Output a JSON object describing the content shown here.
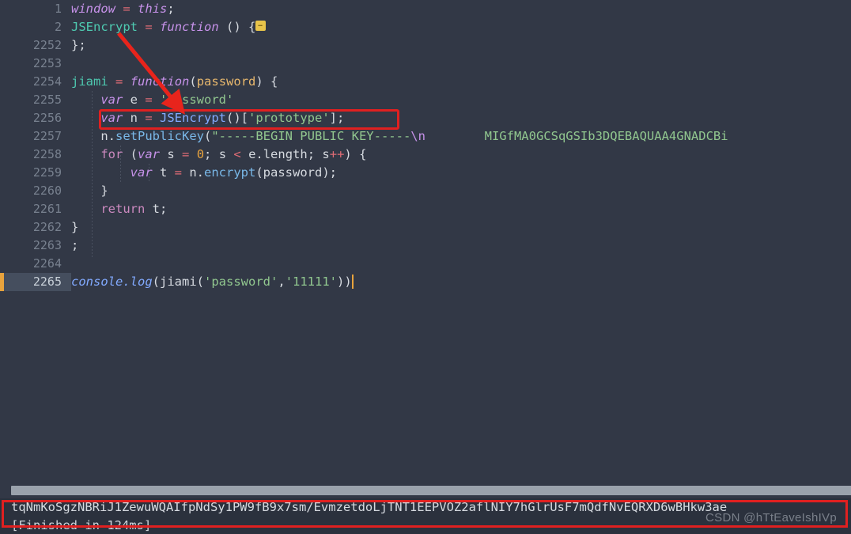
{
  "editor": {
    "background": "#323846",
    "gutter_active_bg": "#454e5e",
    "caret_color": "#e8a33d",
    "lines": [
      {
        "number": "1",
        "active": false
      },
      {
        "number": "2",
        "active": false
      },
      {
        "number": "2252",
        "active": false
      },
      {
        "number": "2253",
        "active": false
      },
      {
        "number": "2254",
        "active": false
      },
      {
        "number": "2255",
        "active": false
      },
      {
        "number": "2256",
        "active": false
      },
      {
        "number": "2257",
        "active": false
      },
      {
        "number": "2258",
        "active": false
      },
      {
        "number": "2259",
        "active": false
      },
      {
        "number": "2260",
        "active": false
      },
      {
        "number": "2261",
        "active": false
      },
      {
        "number": "2262",
        "active": false
      },
      {
        "number": "2263",
        "active": false
      },
      {
        "number": "2264",
        "active": false
      },
      {
        "number": "2265",
        "active": true
      }
    ],
    "code_text": [
      "window = this;",
      "JSEncrypt = function () {…",
      "};",
      "",
      "jiami = function(password) {",
      "    var e = 'password'",
      "    var n = JSEncrypt()['prototype'];",
      "    n.setPublicKey(\"-----BEGIN PUBLIC KEY-----\\n        MIGfMA0GCSqGSIb3DQEBAQUAA4GNADCBi",
      "    for (var s = 0; s < e.length; s++) {",
      "        var t = n.encrypt(password);",
      "    }",
      "    return t;",
      "}",
      ";",
      "",
      "console.log(jiami('password','11111'))"
    ],
    "fold_marker": "…"
  },
  "annotations": {
    "highlight_box_color": "#e02020",
    "arrow_color": "#e8241c",
    "arrow_from": "JSEncrypt = function",
    "arrow_to": "var n = JSEncrypt()['prototype'];"
  },
  "scrollbar": {
    "orientation": "horizontal",
    "thumb_color": "#9aa2ac"
  },
  "console": {
    "output_line": "tqNmKoSgzNBRiJ1ZewuWQAIfpNdSy1PW9fB9x7sm/EvmzetdoLjTNT1EEPVOZ2aflNIY7hGlrUsF7mQdfNvEQRXD6wBHkw3ae",
    "status_line": "[Finished in 124ms]"
  },
  "watermark": "CSDN @hTtEaveIshIVp"
}
